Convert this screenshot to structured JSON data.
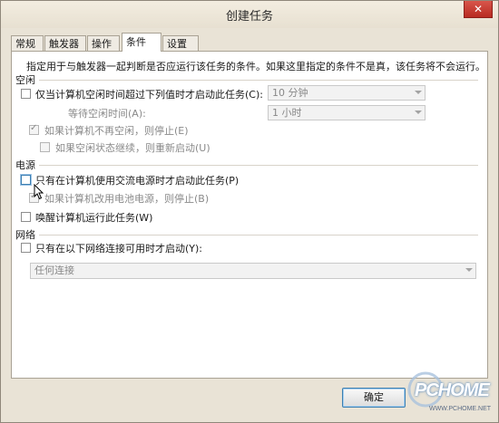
{
  "window": {
    "title": "创建任务",
    "close_label": "✕"
  },
  "tabs": [
    "常规",
    "触发器",
    "操作",
    "条件",
    "设置"
  ],
  "description": "指定用于与触发器一起判断是否应运行该任务的条件。如果这里指定的条件不是真，该任务将不会运行。",
  "idle": {
    "section": "空闲",
    "start_only_if_idle": "仅当计算机空闲时间超过下列值时才启动此任务(C):",
    "idle_for_value": "10 分钟",
    "wait_label": "等待空闲时间(A):",
    "wait_value": "1 小时",
    "stop_if_not_idle": "如果计算机不再空闲，则停止(E)",
    "restart_if_idle_resumes": "如果空闲状态继续，则重新启动(U)"
  },
  "power": {
    "section": "电源",
    "ac_only": "只有在计算机使用交流电源时才启动此任务(P)",
    "stop_on_battery": "如果计算机改用电池电源，则停止(B)",
    "wake": "唤醒计算机运行此任务(W)"
  },
  "network": {
    "section": "网络",
    "network_only": "只有在以下网络连接可用时才启动(Y):",
    "connection_value": "任何连接"
  },
  "buttons": {
    "ok": "确定"
  },
  "watermark": {
    "brand": "PCHOME",
    "url": "WWW.PCHOME.NET"
  }
}
